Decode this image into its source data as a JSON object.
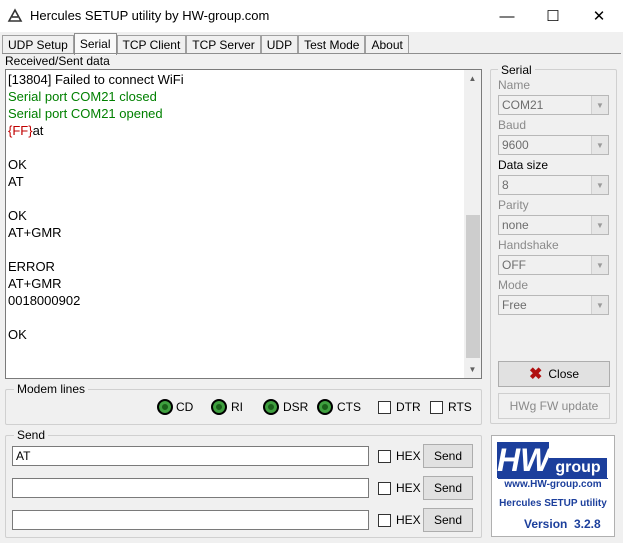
{
  "window": {
    "title": "Hercules SETUP utility by HW-group.com",
    "minimize": "—",
    "maximize": "☐",
    "close": "✕"
  },
  "tabs": [
    {
      "label": "UDP Setup",
      "active": false
    },
    {
      "label": "Serial",
      "active": true
    },
    {
      "label": "TCP Client",
      "active": false
    },
    {
      "label": "TCP Server",
      "active": false
    },
    {
      "label": "UDP",
      "active": false
    },
    {
      "label": "Test Mode",
      "active": false
    },
    {
      "label": "About",
      "active": false
    }
  ],
  "received": {
    "label": "Received/Sent data",
    "lines": [
      {
        "text": "[13804] Failed to connect WiFi",
        "color": "#000000"
      },
      {
        "text": "Serial port COM21 closed",
        "color": "#008000"
      },
      {
        "text": "Serial port COM21 opened",
        "color": "#008000"
      },
      {
        "prefix": "{FF}",
        "prefix_color": "#c00000",
        "text": "at",
        "color": "#000000"
      },
      {
        "text": "",
        "color": "#000000"
      },
      {
        "text": "OK",
        "color": "#000000"
      },
      {
        "text": "AT",
        "color": "#000000"
      },
      {
        "text": "",
        "color": "#000000"
      },
      {
        "text": "OK",
        "color": "#000000"
      },
      {
        "text": "AT+GMR",
        "color": "#000000"
      },
      {
        "text": "",
        "color": "#000000"
      },
      {
        "text": "ERROR",
        "color": "#000000"
      },
      {
        "text": "AT+GMR",
        "color": "#000000"
      },
      {
        "text": "0018000902",
        "color": "#000000"
      },
      {
        "text": "",
        "color": "#000000"
      },
      {
        "text": "OK",
        "color": "#000000"
      }
    ]
  },
  "modem": {
    "title": "Modem lines",
    "leds": [
      "CD",
      "RI",
      "DSR",
      "CTS"
    ],
    "checks": [
      "DTR",
      "RTS"
    ]
  },
  "send": {
    "title": "Send",
    "rows": [
      {
        "value": "AT",
        "hex_label": "HEX",
        "button": "Send"
      },
      {
        "value": "",
        "hex_label": "HEX",
        "button": "Send"
      },
      {
        "value": "",
        "hex_label": "HEX",
        "button": "Send"
      }
    ]
  },
  "serial": {
    "title": "Serial",
    "fields": [
      {
        "label": "Name",
        "value": "COM21",
        "enabled": false
      },
      {
        "label": "Baud",
        "value": "9600",
        "enabled": false
      },
      {
        "label": "Data size",
        "value": "8",
        "enabled": true
      },
      {
        "label": "Parity",
        "value": "none",
        "enabled": false
      },
      {
        "label": "Handshake",
        "value": "OFF",
        "enabled": false
      },
      {
        "label": "Mode",
        "value": "Free",
        "enabled": false
      }
    ],
    "close_button": "Close",
    "hwg_button": "HWg FW update"
  },
  "logo": {
    "brand": "HW",
    "brand_suffix": "group",
    "url": "www.HW-group.com",
    "product": "Hercules SETUP utility",
    "version_label": "Version",
    "version": "3.2.8"
  },
  "colors": {
    "accent_blue": "#1c3f9c",
    "led_green": "#3f9f3f",
    "close_icon": "#b01010"
  }
}
